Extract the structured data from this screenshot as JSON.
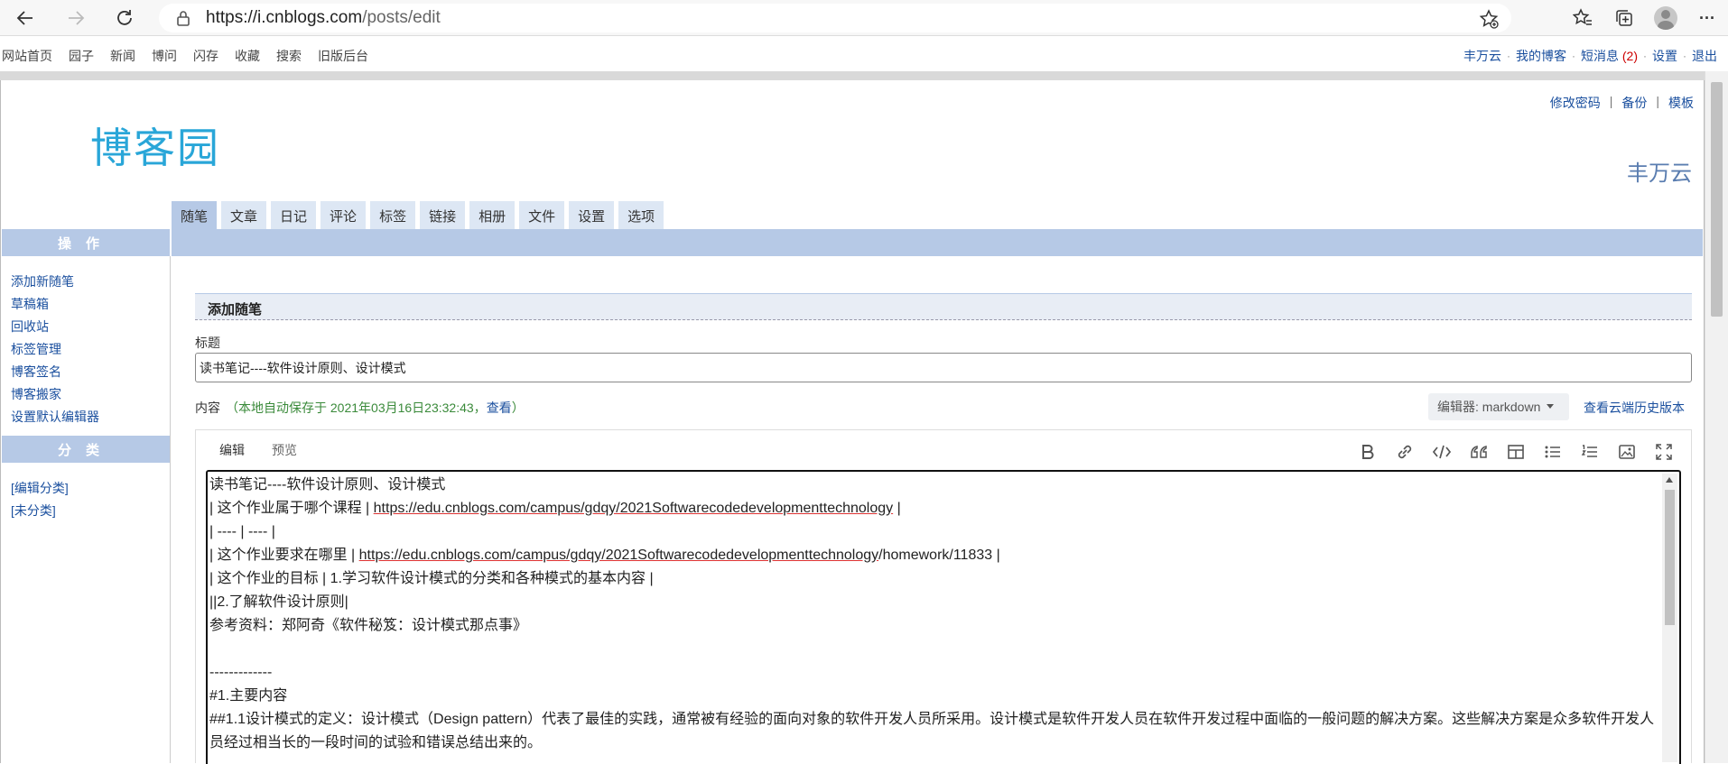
{
  "browser": {
    "url_host": "https://i.cnblogs.com",
    "url_path": "/posts/edit"
  },
  "site_nav": {
    "left_links": [
      "网站首页",
      "园子",
      "新闻",
      "博问",
      "闪存",
      "收藏",
      "搜索",
      "旧版后台"
    ],
    "user": "丰万云",
    "my_blog": "我的博客",
    "messages": "短消息",
    "message_count": "(2)",
    "settings": "设置",
    "logout": "退出"
  },
  "header": {
    "logo_text": "博客园",
    "links": [
      "修改密码",
      "备份",
      "模板"
    ],
    "blog_name": "丰万云"
  },
  "tabs": [
    "随笔",
    "文章",
    "日记",
    "评论",
    "标签",
    "链接",
    "相册",
    "文件",
    "设置",
    "选项"
  ],
  "sidebar": {
    "ops_title": "操作",
    "ops_items": [
      "添加新随笔",
      "草稿箱",
      "回收站",
      "标签管理",
      "博客签名",
      "博客搬家",
      "设置默认编辑器"
    ],
    "cat_title": "分类",
    "cat_items": [
      "[编辑分类]",
      "[未分类]"
    ]
  },
  "form": {
    "section_title": "添加随笔",
    "title_label": "标题",
    "title_value": "读书笔记----软件设计原则、设计模式",
    "content_label": "内容",
    "autosave_text": "（本地自动保存于 2021年03月16日23:32:43，",
    "view_link": "查看",
    "autosave_close": "）",
    "editor_select": "编辑器: markdown",
    "cloud_history": "查看云端历史版本"
  },
  "editor": {
    "tab_edit": "编辑",
    "tab_preview": "预览",
    "tools": [
      "bold-icon",
      "link-icon",
      "code-icon",
      "quote-icon",
      "table-icon",
      "bullet-list-icon",
      "numbered-list-icon",
      "image-icon",
      "fullscreen-icon"
    ],
    "lines": {
      "l1": "读书笔记----软件设计原则、设计模式",
      "l2_pre": "|  这个作业属于哪个课程   | ",
      "l2_link": "https://edu.cnblogs.com/campus/gdqy/2021Softwarecodedevelopmenttechnology",
      "l2_post": "  |",
      "l3": "|  ----  | ----  |",
      "l4_pre": "| 这个作业要求在哪里  | ",
      "l4_link": "https://edu.cnblogs.com/campus/gdqy/2021Softwarecodedevelopmenttechnology",
      "l4_post": "/homework/11833 |",
      "l5": "| 这个作业的目标  | 1.学习软件设计模式的分类和各种模式的基本内容  |",
      "l6": "||2.了解软件设计原则|",
      "l7": "参考资料：郑阿奇《软件秘笈：设计模式那点事》",
      "l8": "",
      "l9": "-------------",
      "l10": "#1.主要内容",
      "l11": "##1.1设计模式的定义：设计模式（Design pattern）代表了最佳的实践，通常被有经验的面向对象的软件开发人员所采用。设计模式是软件开发人员在软件开发过程中面临的一般问题的解决方案。这些解决方案是众多软件开发人员经过相当长的一段时间的试验和错误总结出来的。"
    }
  }
}
